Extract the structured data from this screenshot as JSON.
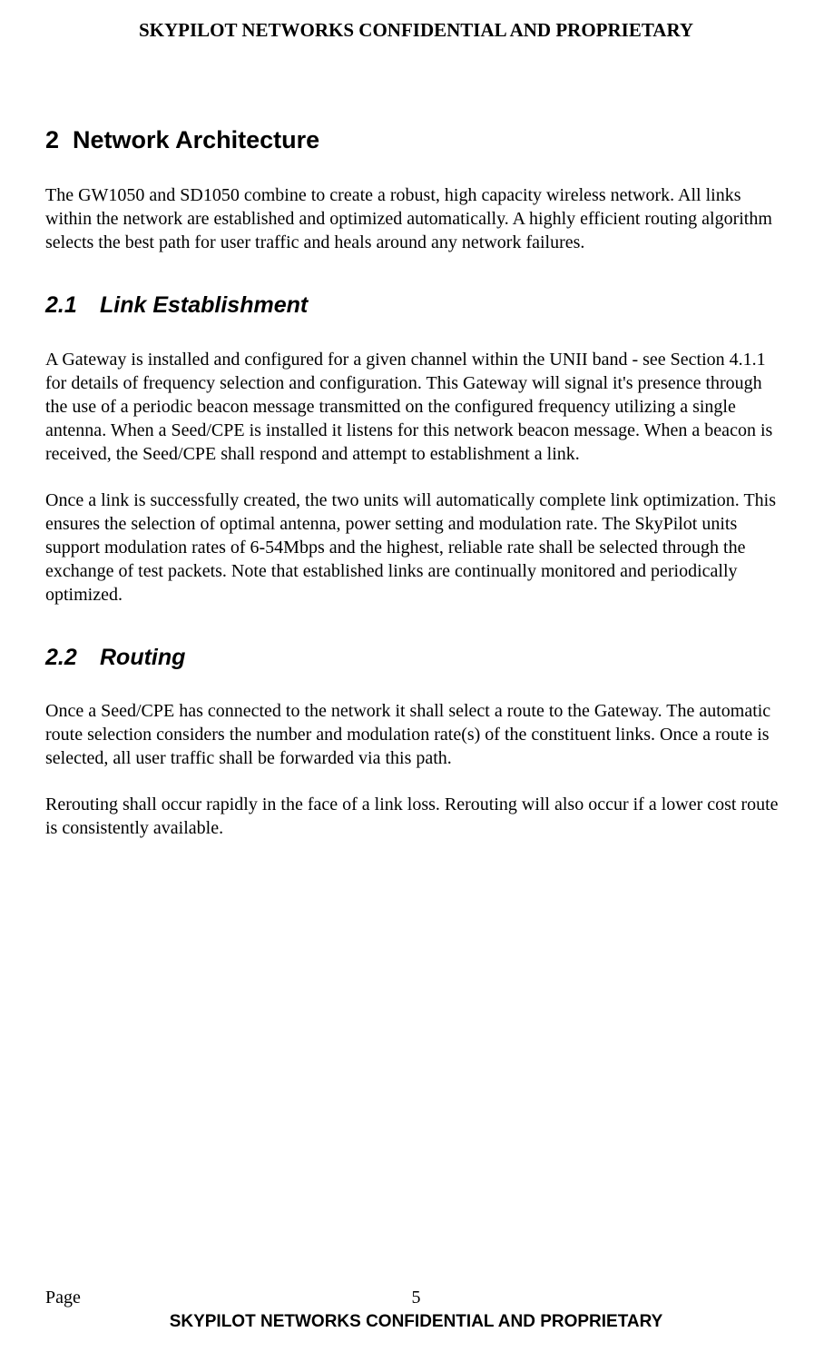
{
  "header": "SKYPILOT NETWORKS CONFIDENTIAL AND PROPRIETARY",
  "section": {
    "number": "2",
    "title": "Network Architecture",
    "intro": "The GW1050 and SD1050 combine to create a robust, high capacity wireless network. All links within the network are established and optimized automatically. A highly efficient routing algorithm selects the best path for user traffic and heals around any network failures.",
    "sub1": {
      "number": "2.1",
      "title": "Link Establishment",
      "p1": "A Gateway is installed and configured for a given channel within the UNII band - see Section 4.1.1 for details of frequency selection and configuration. This Gateway will signal it's presence through the use of a periodic beacon message transmitted on the configured frequency utilizing a single antenna. When a Seed/CPE is installed it listens for this network beacon message. When a beacon is received, the Seed/CPE shall respond and attempt to establishment a link.",
      "p2": "Once a link is successfully created, the two units will automatically complete link optimization. This ensures the selection of optimal antenna, power setting and modulation rate. The SkyPilot units support modulation rates of 6-54Mbps and the highest, reliable rate shall be selected through the exchange of test packets. Note that established links are continually monitored and periodically optimized."
    },
    "sub2": {
      "number": "2.2",
      "title": "Routing",
      "p1": "Once a Seed/CPE has connected to the network it shall select a route to the Gateway. The automatic route selection considers the number and modulation rate(s) of the constituent links. Once a route is selected, all user traffic shall be forwarded via this path.",
      "p2": "Rerouting shall occur rapidly in the face of a link loss. Rerouting will also occur if a lower cost route is consistently available."
    }
  },
  "footer": {
    "page_label": "Page",
    "page_number": "5",
    "confidential": "SKYPILOT NETWORKS CONFIDENTIAL AND PROPRIETARY"
  }
}
